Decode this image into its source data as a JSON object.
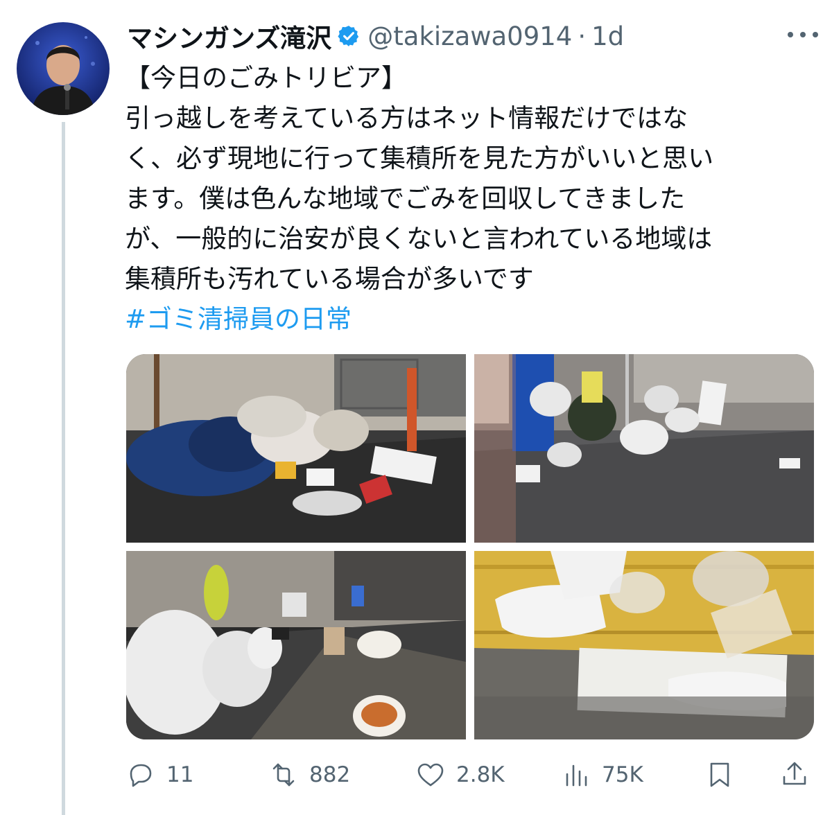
{
  "tweet": {
    "author_name": "マシンガンズ滝沢",
    "handle": "@takizawa0914",
    "separator": "·",
    "time": "1d",
    "text_lines": [
      "【今日のごみトリビア】",
      "引っ越しを考えている方はネット情報だけではな",
      "く、必ず現地に行って集積所を見た方がいいと思い",
      "ます。僕は色んな地域でごみを回収してきました",
      "が、一般的に治安が良くないと言われている地域は",
      "集積所も汚れている場合が多いです"
    ],
    "hashtag": "#ゴミ清掃員の日常"
  },
  "actions": {
    "replies": "11",
    "reposts": "882",
    "likes": "2.8K",
    "views": "75K"
  },
  "icons": {
    "verified": "verified-badge-icon",
    "more": "more-dots-icon",
    "reply": "reply-bubble-icon",
    "repost": "repost-arrows-icon",
    "like": "heart-icon",
    "views": "bar-chart-icon",
    "bookmark": "bookmark-icon",
    "share": "share-upload-icon"
  },
  "colors": {
    "text": "#0f1419",
    "secondary": "#536471",
    "link": "#1d9bf0",
    "thread_line": "#cfd9de"
  }
}
